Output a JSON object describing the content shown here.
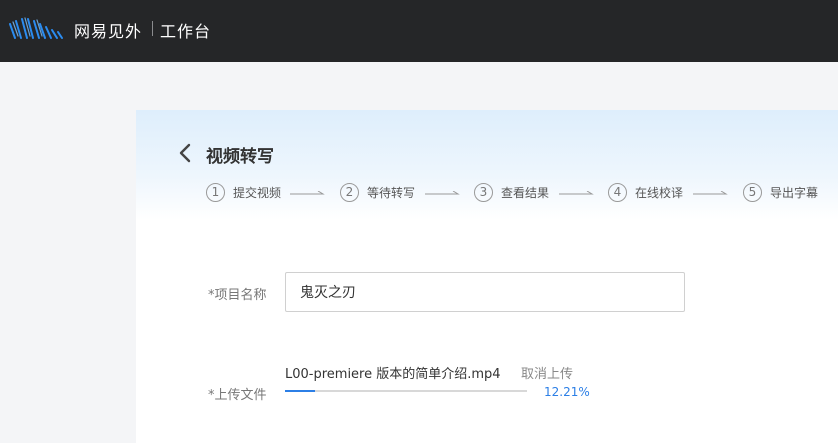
{
  "header": {
    "brand": "网易见外",
    "workspace": "工作台",
    "logo_icon": "wave-logo-icon",
    "logo_color": "#2b8cf0"
  },
  "page": {
    "title": "视频转写",
    "back_icon": "chevron-left-icon"
  },
  "steps": [
    {
      "num": "1",
      "label": "提交视频"
    },
    {
      "num": "2",
      "label": "等待转写"
    },
    {
      "num": "3",
      "label": "查看结果"
    },
    {
      "num": "4",
      "label": "在线校译"
    },
    {
      "num": "5",
      "label": "导出字幕"
    }
  ],
  "form": {
    "project_name_label": "*项目名称",
    "project_name_value": "鬼灭之刃",
    "upload_label": "*上传文件",
    "file_name": "L00-premiere 版本的简单介绍.mp4",
    "cancel_upload": "取消上传",
    "progress_text": "12.21%",
    "progress_fraction": 0.1221
  },
  "colors": {
    "topbar": "#252628",
    "accent": "#2c7fe6"
  }
}
